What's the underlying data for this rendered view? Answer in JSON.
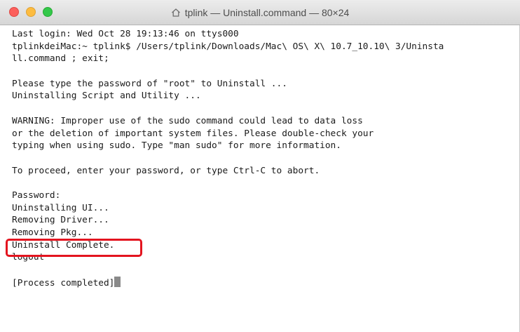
{
  "window": {
    "title": "tplink — Uninstall.command — 80×24",
    "icons": {
      "close": "close-icon",
      "minimize": "minimize-icon",
      "zoom": "zoom-icon",
      "title": "home-icon"
    }
  },
  "terminal": {
    "lines": [
      "Last login: Wed Oct 28 19:13:46 on ttys000",
      "tplinkdeiMac:~ tplink$ /Users/tplink/Downloads/Mac\\ OS\\ X\\ 10.7_10.10\\ 3/Uninsta",
      "ll.command ; exit;",
      "",
      "Please type the password of \"root\" to Uninstall ...",
      "Uninstalling Script and Utility ...",
      "",
      "WARNING: Improper use of the sudo command could lead to data loss",
      "or the deletion of important system files. Please double-check your",
      "typing when using sudo. Type \"man sudo\" for more information.",
      "",
      "To proceed, enter your password, or type Ctrl-C to abort.",
      "",
      "Password:",
      "Uninstalling UI...",
      "Removing Driver...",
      "Removing Pkg...",
      "Uninstall Complete.",
      "logout",
      "",
      "[Process completed]"
    ]
  },
  "colors": {
    "highlight": "#e3141f",
    "text": "#1a1a1a",
    "background": "#ffffff"
  }
}
